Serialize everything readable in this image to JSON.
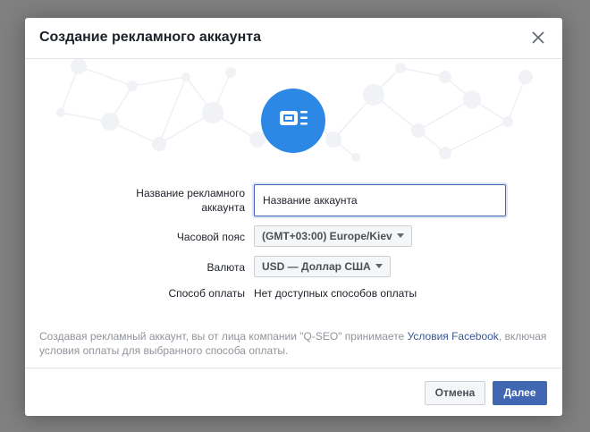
{
  "dialog": {
    "title": "Создание рекламного аккаунта",
    "close_icon": "close-icon",
    "illustration_icon": "ad-account-icon"
  },
  "form": {
    "account_name": {
      "label_line1": "Название рекламного",
      "label_line2": "аккаунта",
      "value": "Название аккаунта"
    },
    "timezone": {
      "label": "Часовой пояс",
      "value": "(GMT+03:00) Europe/Kiev"
    },
    "currency": {
      "label": "Валюта",
      "value": "USD — Доллар США"
    },
    "payment": {
      "label": "Способ оплаты",
      "value": "Нет доступных способов оплаты"
    }
  },
  "disclaimer": {
    "text_before": "Создавая рекламный аккаунт, вы от лица компании \"Q-SEO\" принимаете ",
    "link": "Условия Facebook",
    "text_after": ", включая условия оплаты для выбранного способа оплаты."
  },
  "footer": {
    "cancel_label": "Отмена",
    "next_label": "Далее"
  },
  "colors": {
    "accent": "#4267b2",
    "badge": "#2d88e5",
    "link": "#385898"
  }
}
